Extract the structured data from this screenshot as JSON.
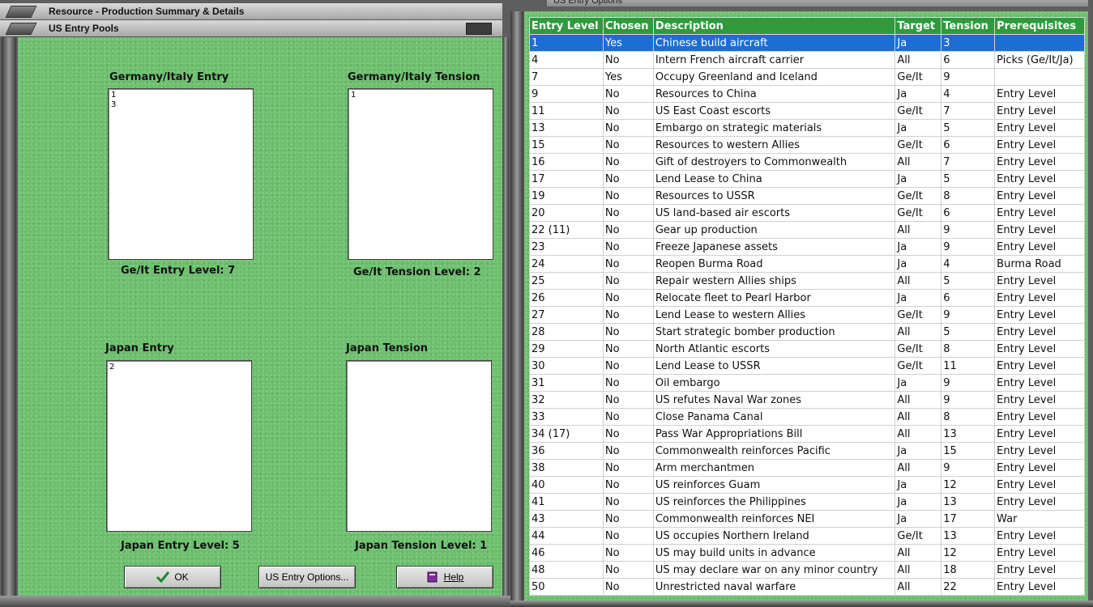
{
  "left_window": {
    "title": "Resource - Production Summary & Details",
    "subtitle": "US Entry Pools",
    "pools": {
      "gi_entry": {
        "title": "Germany/Italy Entry",
        "items": [
          "1",
          "3"
        ],
        "level_text": "Ge/It Entry Level: 7"
      },
      "gi_tension": {
        "title": "Germany/Italy Tension",
        "items": [
          "1"
        ],
        "level_text": "Ge/It Tension Level: 2"
      },
      "jp_entry": {
        "title": "Japan Entry",
        "items": [
          "2"
        ],
        "level_text": "Japan Entry Level: 5"
      },
      "jp_tension": {
        "title": "Japan Tension",
        "items": [],
        "level_text": "Japan Tension Level: 1"
      }
    },
    "buttons": {
      "ok": "OK",
      "options": "US Entry Options...",
      "help": "Help"
    }
  },
  "right_window": {
    "title": "US Entry Options",
    "columns": [
      "Entry Level",
      "Chosen",
      "Description",
      "Target",
      "Tension",
      "Prerequisites"
    ],
    "selected_row": 0,
    "rows": [
      [
        "1",
        "Yes",
        "Chinese build aircraft",
        "Ja",
        "3",
        ""
      ],
      [
        "4",
        "No",
        "Intern French aircraft carrier",
        "All",
        "6",
        "Picks (Ge/It/Ja)"
      ],
      [
        "7",
        "Yes",
        "Occupy Greenland and Iceland",
        "Ge/It",
        "9",
        ""
      ],
      [
        "9",
        "No",
        "Resources to China",
        "Ja",
        "4",
        "Entry Level"
      ],
      [
        "11",
        "No",
        "US East Coast escorts",
        "Ge/It",
        "7",
        "Entry Level"
      ],
      [
        "13",
        "No",
        "Embargo on strategic materials",
        "Ja",
        "5",
        "Entry Level"
      ],
      [
        "15",
        "No",
        "Resources to western Allies",
        "Ge/It",
        "6",
        "Entry Level"
      ],
      [
        "16",
        "No",
        "Gift of destroyers to Commonwealth",
        "All",
        "7",
        "Entry Level"
      ],
      [
        "17",
        "No",
        "Lend Lease to China",
        "Ja",
        "5",
        "Entry Level"
      ],
      [
        "19",
        "No",
        "Resources to USSR",
        "Ge/It",
        "8",
        "Entry Level"
      ],
      [
        "20",
        "No",
        "US land-based air escorts",
        "Ge/It",
        "6",
        "Entry Level"
      ],
      [
        "22 (11)",
        "No",
        "Gear up production",
        "All",
        "9",
        "Entry Level"
      ],
      [
        "23",
        "No",
        "Freeze Japanese assets",
        "Ja",
        "9",
        "Entry Level"
      ],
      [
        "24",
        "No",
        "Reopen Burma Road",
        "Ja",
        "4",
        "Burma Road"
      ],
      [
        "25",
        "No",
        "Repair western Allies ships",
        "All",
        "5",
        "Entry Level"
      ],
      [
        "26",
        "No",
        "Relocate fleet to Pearl Harbor",
        "Ja",
        "6",
        "Entry Level"
      ],
      [
        "27",
        "No",
        "Lend Lease to western Allies",
        "Ge/It",
        "9",
        "Entry Level"
      ],
      [
        "28",
        "No",
        "Start strategic bomber production",
        "All",
        "5",
        "Entry Level"
      ],
      [
        "29",
        "No",
        "North Atlantic escorts",
        "Ge/It",
        "8",
        "Entry Level"
      ],
      [
        "30",
        "No",
        "Lend Lease to USSR",
        "Ge/It",
        "11",
        "Entry Level"
      ],
      [
        "31",
        "No",
        "Oil embargo",
        "Ja",
        "9",
        "Entry Level"
      ],
      [
        "32",
        "No",
        "US refutes Naval War zones",
        "All",
        "9",
        "Entry Level"
      ],
      [
        "33",
        "No",
        "Close Panama Canal",
        "All",
        "8",
        "Entry Level"
      ],
      [
        "34 (17)",
        "No",
        "Pass War Appropriations Bill",
        "All",
        "13",
        "Entry Level"
      ],
      [
        "36",
        "No",
        "Commonwealth reinforces Pacific",
        "Ja",
        "15",
        "Entry Level"
      ],
      [
        "38",
        "No",
        "Arm merchantmen",
        "All",
        "9",
        "Entry Level"
      ],
      [
        "40",
        "No",
        "US reinforces Guam",
        "Ja",
        "12",
        "Entry Level"
      ],
      [
        "41",
        "No",
        "US reinforces the Philippines",
        "Ja",
        "13",
        "Entry Level"
      ],
      [
        "43",
        "No",
        "Commonwealth reinforces NEI",
        "Ja",
        "17",
        "War"
      ],
      [
        "44",
        "No",
        "US occupies Northern Ireland",
        "Ge/It",
        "13",
        "Entry Level"
      ],
      [
        "46",
        "No",
        "US may build units in advance",
        "All",
        "12",
        "Entry Level"
      ],
      [
        "48",
        "No",
        "US may declare war on any minor country",
        "All",
        "18",
        "Entry Level"
      ],
      [
        "50",
        "No",
        "Unrestricted naval warfare",
        "All",
        "22",
        "Entry Level"
      ]
    ]
  },
  "colors": {
    "header_green": "#2f9a3c",
    "selection_blue": "#1c6ed4",
    "background_green": "#6cc06e"
  },
  "icons": {
    "ok_button": "checkmark-icon",
    "help_button": "help-book-icon"
  }
}
